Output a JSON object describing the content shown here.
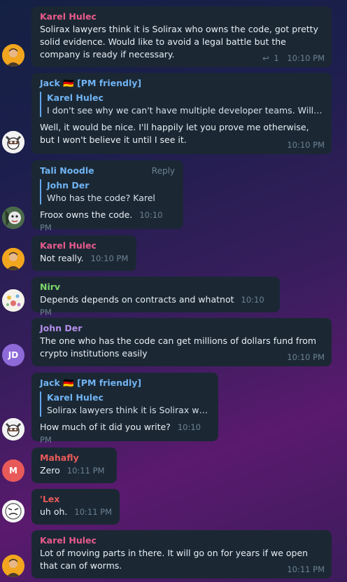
{
  "colors": {
    "karel": "#e8598b",
    "jack": "#71b3f2",
    "tali": "#71b3f2",
    "nirv": "#7ed86a",
    "john": "#b28de8",
    "mahafly": "#e85a5a",
    "lex": "#e85a5a",
    "bubble": "#1b2834",
    "time": "#6d8191"
  },
  "messages": [
    {
      "sender": "Karel Hulec",
      "text": "Solirax lawyers think it is Solirax who owns the code, got pretty solid evidence. Would like to avoid a legal battle but the company is ready if necessary.",
      "reply_count": "1",
      "time": "10:10 PM"
    },
    {
      "sender": "Jack 🇩🇪 [PM friendly]",
      "quote_name": "Karel Hulec",
      "quote_text": "I don't see why we can't have multiple developer teams. Will be h...",
      "text": "Well, it would be nice. I'll happily let you prove me otherwise, but I won't believe it until I see it.",
      "time": "10:10 PM"
    },
    {
      "sender": "Tali Noodle",
      "reply_label": "Reply",
      "quote_name": "John Der",
      "quote_text": "Who has the code? Karel",
      "text": "Froox owns the code.",
      "time": "10:10 PM"
    },
    {
      "sender": "Karel Hulec",
      "text": "Not really.",
      "time": "10:10 PM"
    },
    {
      "sender": "Nirv",
      "text": "Depends depends on contracts and whatnot",
      "time": "10:10 PM"
    },
    {
      "sender": "John Der",
      "avatar_initials": "JD",
      "text": "The one who has the code can get millions of dollars fund from crypto institutions easily",
      "time": "10:10 PM"
    },
    {
      "sender": "Jack 🇩🇪 [PM friendly]",
      "quote_name": "Karel Hulec",
      "quote_text": "Solirax lawyers think it is Solirax who ...",
      "text": "How much of it did you write?",
      "time": "10:10 PM"
    },
    {
      "sender": "Mahafly",
      "avatar_initials": "M",
      "text": "Zero",
      "time": "10:11 PM"
    },
    {
      "sender": "'Lex",
      "text": "uh oh.",
      "time": "10:11 PM"
    },
    {
      "sender": "Karel Hulec",
      "text": "Lot of moving parts in there. It will go on for years if we open that can of worms.",
      "time": "10:11 PM"
    }
  ]
}
